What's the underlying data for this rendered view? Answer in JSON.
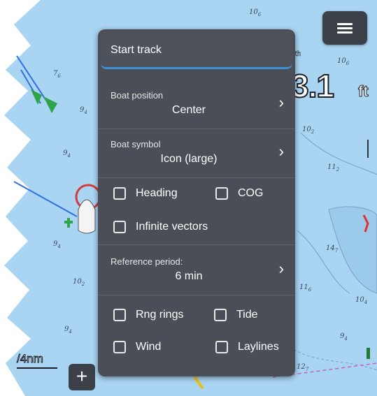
{
  "map": {
    "soundings": [
      {
        "main": "10",
        "sub": "6"
      },
      {
        "main": "7",
        "sub": "6"
      },
      {
        "main": "9",
        "sub": "4"
      },
      {
        "main": "9",
        "sub": "4"
      },
      {
        "main": "9",
        "sub": "4"
      },
      {
        "main": "10",
        "sub": "2"
      },
      {
        "main": "10",
        "sub": "2"
      },
      {
        "main": "11",
        "sub": "2"
      },
      {
        "main": "14",
        "sub": "7"
      },
      {
        "main": "11",
        "sub": "6"
      },
      {
        "main": "10",
        "sub": "4"
      },
      {
        "main": "9",
        "sub": "4"
      },
      {
        "main": "9",
        "sub": "4"
      },
      {
        "main": "12",
        "sub": "7"
      },
      {
        "main": "10",
        "sub": "6"
      }
    ],
    "depth_label": "th",
    "depth_value": "3.1",
    "depth_unit": "ft",
    "scale_label": "/4nm",
    "zoom_in_label": "+"
  },
  "menu_icon": "hamburger-icon",
  "panel": {
    "start_track": "Start track",
    "boat_position": {
      "label": "Boat position",
      "value": "Center"
    },
    "boat_symbol": {
      "label": "Boat symbol",
      "value": "Icon (large)"
    },
    "reference_period": {
      "label": "Reference period:",
      "value": "6 min"
    },
    "checkboxes": {
      "heading": "Heading",
      "cog": "COG",
      "infinite_vectors": "Infinite vectors",
      "rng_rings": "Rng rings",
      "tide": "Tide",
      "wind": "Wind",
      "laylines": "Laylines"
    },
    "chevron": "›"
  }
}
